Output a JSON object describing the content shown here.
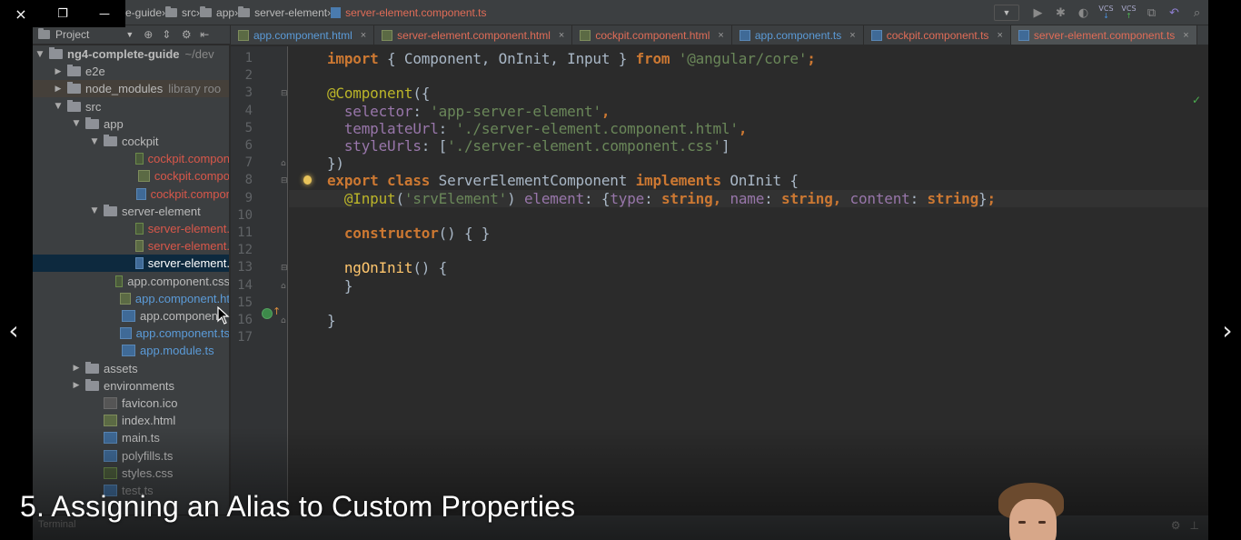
{
  "player": {
    "close_icon": "×",
    "restore_icon": "❐",
    "minimize_icon": "—",
    "prev_icon": "‹",
    "next_icon": "›",
    "video_title": "5. Assigning an Alias to Custom Properties"
  },
  "breadcrumbs": [
    {
      "label": "e-guide",
      "type": "folder"
    },
    {
      "label": "src",
      "type": "folder"
    },
    {
      "label": "app",
      "type": "folder"
    },
    {
      "label": "server-element",
      "type": "folder"
    },
    {
      "label": "server-element.component.ts",
      "type": "ts-file"
    }
  ],
  "project_panel": {
    "header": "Project",
    "tree": [
      {
        "label": "ng4-complete-guide",
        "suffix": "~/dev",
        "depth": 0,
        "arrow": "▼",
        "icon": "folder",
        "color": "bold"
      },
      {
        "label": "e2e",
        "depth": 1,
        "arrow": "▶",
        "icon": "folder",
        "color": "normal"
      },
      {
        "label": "node_modules",
        "suffix": "library roo",
        "depth": 1,
        "arrow": "▶",
        "icon": "folder",
        "color": "normal",
        "highlight": true
      },
      {
        "label": "src",
        "depth": 1,
        "arrow": "▼",
        "icon": "folder",
        "color": "normal"
      },
      {
        "label": "app",
        "depth": 2,
        "arrow": "▼",
        "icon": "folder",
        "color": "normal"
      },
      {
        "label": "cockpit",
        "depth": 3,
        "arrow": "▼",
        "icon": "folder",
        "color": "normal"
      },
      {
        "label": "cockpit.compon",
        "depth": 5,
        "icon": "css",
        "color": "red"
      },
      {
        "label": "cockpit.compo",
        "depth": 5,
        "icon": "html",
        "color": "red"
      },
      {
        "label": "cockpit.compor",
        "depth": 5,
        "icon": "ts",
        "color": "red"
      },
      {
        "label": "server-element",
        "depth": 3,
        "arrow": "▼",
        "icon": "folder",
        "color": "normal"
      },
      {
        "label": "server-element.",
        "depth": 5,
        "icon": "css",
        "color": "red"
      },
      {
        "label": "server-element.",
        "depth": 5,
        "icon": "html",
        "color": "red"
      },
      {
        "label": "server-element.",
        "depth": 5,
        "icon": "ts",
        "color": "normal",
        "selected": true
      },
      {
        "label": "app.component.css",
        "depth": 4,
        "icon": "css",
        "color": "normal"
      },
      {
        "label": "app.component.ht",
        "depth": 4,
        "icon": "html",
        "color": "blue"
      },
      {
        "label": "app.component.",
        "depth": 4,
        "icon": "ts",
        "color": "normal"
      },
      {
        "label": "app.component.ts",
        "depth": 4,
        "icon": "ts",
        "color": "blue"
      },
      {
        "label": "app.module.ts",
        "depth": 4,
        "icon": "ts",
        "color": "blue"
      },
      {
        "label": "assets",
        "depth": 2,
        "arrow": "▶",
        "icon": "folder",
        "color": "normal"
      },
      {
        "label": "environments",
        "depth": 2,
        "arrow": "▶",
        "icon": "folder",
        "color": "normal"
      },
      {
        "label": "favicon.ico",
        "depth": 3,
        "icon": "ico",
        "color": "normal"
      },
      {
        "label": "index.html",
        "depth": 3,
        "icon": "html",
        "color": "normal"
      },
      {
        "label": "main.ts",
        "depth": 3,
        "icon": "ts",
        "color": "normal"
      },
      {
        "label": "polyfills.ts",
        "depth": 3,
        "icon": "ts",
        "color": "normal"
      },
      {
        "label": "styles.css",
        "depth": 3,
        "icon": "css",
        "color": "normal"
      },
      {
        "label": "test.ts",
        "depth": 3,
        "icon": "ts",
        "color": "normal"
      }
    ]
  },
  "tabs": [
    {
      "label": "app.component.html",
      "icon": "html",
      "color": "#5b9bd8",
      "close": "×"
    },
    {
      "label": "server-element.component.html",
      "icon": "html",
      "color": "#e06c57",
      "close": "×"
    },
    {
      "label": "cockpit.component.html",
      "icon": "html",
      "color": "#e06c57",
      "close": "×"
    },
    {
      "label": "app.component.ts",
      "icon": "ts",
      "color": "#5b9bd8",
      "close": "×"
    },
    {
      "label": "cockpit.component.ts",
      "icon": "ts",
      "color": "#e06c57",
      "close": "×"
    },
    {
      "label": "server-element.component.ts",
      "icon": "ts",
      "color": "#e06c57",
      "close": "×",
      "active": true
    }
  ],
  "editor": {
    "line_numbers": [
      "1",
      "2",
      "3",
      "4",
      "5",
      "6",
      "7",
      "8",
      "9",
      "10",
      "11",
      "12",
      "13",
      "14",
      "15",
      "16",
      "17"
    ],
    "current_line": 9,
    "lines": [
      [
        [
          "kw",
          "import"
        ],
        [
          "def",
          " { Component, OnInit, Input } "
        ],
        [
          "kw",
          "from"
        ],
        [
          "def",
          " "
        ],
        [
          "str",
          "'@angular/core'"
        ],
        [
          "kw",
          ";"
        ]
      ],
      [],
      [
        [
          "ann",
          "@Component"
        ],
        [
          "def",
          "({"
        ]
      ],
      [
        [
          "def",
          "  "
        ],
        [
          "pm",
          "selector"
        ],
        [
          "def",
          ": "
        ],
        [
          "str",
          "'app-server-element'"
        ],
        [
          "kw",
          ","
        ]
      ],
      [
        [
          "def",
          "  "
        ],
        [
          "pm",
          "templateUrl"
        ],
        [
          "def",
          ": "
        ],
        [
          "str",
          "'./server-element.component.html'"
        ],
        [
          "kw",
          ","
        ]
      ],
      [
        [
          "def",
          "  "
        ],
        [
          "pm",
          "styleUrls"
        ],
        [
          "def",
          ": ["
        ],
        [
          "str",
          "'./server-element.component.css'"
        ],
        [
          "def",
          "]"
        ]
      ],
      [
        [
          "def",
          "})"
        ]
      ],
      [
        [
          "kw",
          "export class"
        ],
        [
          "def",
          " ServerElementComponent "
        ],
        [
          "kw",
          "implements"
        ],
        [
          "def",
          " OnInit {"
        ]
      ],
      [
        [
          "def",
          "  "
        ],
        [
          "ann",
          "@Input"
        ],
        [
          "def",
          "("
        ],
        [
          "str",
          "'srvElement'"
        ],
        [
          "def",
          ") "
        ],
        [
          "pm",
          "element"
        ],
        [
          "def",
          ": {"
        ],
        [
          "pm",
          "type"
        ],
        [
          "def",
          ": "
        ],
        [
          "kw",
          "string"
        ],
        [
          "kw",
          ","
        ],
        [
          "def",
          " "
        ],
        [
          "pm",
          "name"
        ],
        [
          "def",
          ": "
        ],
        [
          "kw",
          "string"
        ],
        [
          "kw",
          ","
        ],
        [
          "def",
          " "
        ],
        [
          "pm",
          "content"
        ],
        [
          "def",
          ": "
        ],
        [
          "kw",
          "string"
        ],
        [
          "def",
          "}"
        ],
        [
          "kw",
          ";"
        ]
      ],
      [],
      [
        [
          "def",
          "  "
        ],
        [
          "kw",
          "constructor"
        ],
        [
          "def",
          "() { }"
        ]
      ],
      [],
      [
        [
          "def",
          "  "
        ],
        [
          "fn",
          "ngOnInit"
        ],
        [
          "def",
          "() {"
        ]
      ],
      [
        [
          "def",
          "  }"
        ]
      ],
      [],
      [
        [
          "def",
          "}"
        ]
      ],
      []
    ]
  },
  "toolbar_right": [
    "run-dropdown",
    "play",
    "debug",
    "coverage",
    "vcs-update",
    "vcs-commit",
    "compare",
    "revert",
    "search"
  ],
  "toolbar_labels": {
    "vcs": "VCS"
  },
  "bottom": {
    "terminal_label": "Terminal"
  },
  "colors": {
    "keyword": "#cc7832",
    "string": "#6a8759",
    "property": "#9876aa",
    "function": "#ffc66d",
    "default": "#a9b7c6"
  }
}
